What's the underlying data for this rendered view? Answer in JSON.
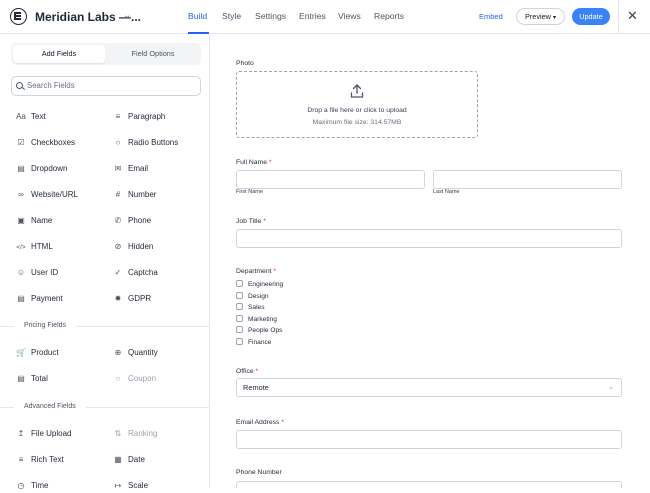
{
  "header": {
    "title": "Meridian Labs —...",
    "tabs": [
      "Build",
      "Style",
      "Settings",
      "Entries",
      "Views",
      "Reports"
    ],
    "embed_label": "Embed",
    "preview_label": "Preview",
    "update_label": "Update"
  },
  "sidebar": {
    "tabs": [
      "Add Fields",
      "Field Options"
    ],
    "search_placeholder": "Search Fields",
    "fields": [
      {
        "label": "Text",
        "icon": "text-icon"
      },
      {
        "label": "Paragraph",
        "icon": "paragraph-icon"
      },
      {
        "label": "Checkboxes",
        "icon": "checkbox-icon"
      },
      {
        "label": "Radio Buttons",
        "icon": "radio-icon"
      },
      {
        "label": "Dropdown",
        "icon": "dropdown-icon"
      },
      {
        "label": "Email",
        "icon": "email-icon"
      },
      {
        "label": "Website/URL",
        "icon": "link-icon"
      },
      {
        "label": "Number",
        "icon": "hash-icon"
      },
      {
        "label": "Name",
        "icon": "name-card-icon"
      },
      {
        "label": "Phone",
        "icon": "phone-icon"
      },
      {
        "label": "HTML",
        "icon": "code-icon"
      },
      {
        "label": "Hidden",
        "icon": "hidden-icon"
      },
      {
        "label": "User ID",
        "icon": "user-icon"
      },
      {
        "label": "Captcha",
        "icon": "shield-check-icon"
      },
      {
        "label": "Payment",
        "icon": "credit-card-icon"
      },
      {
        "label": "GDPR",
        "icon": "gdpr-stars-icon"
      }
    ],
    "pricing_heading": "Pricing Fields",
    "pricing_fields": [
      {
        "label": "Product",
        "icon": "cart-icon",
        "dim": false
      },
      {
        "label": "Quantity",
        "icon": "quantity-icon",
        "dim": false
      },
      {
        "label": "Total",
        "icon": "total-icon",
        "dim": false
      },
      {
        "label": "Coupon",
        "icon": "coupon-icon",
        "dim": true
      }
    ],
    "advanced_heading": "Advanced Fields",
    "advanced_fields": [
      {
        "label": "File Upload",
        "icon": "upload-icon",
        "dim": false
      },
      {
        "label": "Ranking",
        "icon": "ranking-icon",
        "dim": true
      },
      {
        "label": "Rich Text",
        "icon": "rich-text-icon",
        "dim": false
      },
      {
        "label": "Date",
        "icon": "calendar-icon",
        "dim": false
      },
      {
        "label": "Time",
        "icon": "clock-icon",
        "dim": false
      },
      {
        "label": "Scale",
        "icon": "scale-icon",
        "dim": false
      }
    ]
  },
  "form": {
    "photo": {
      "label": "Photo",
      "drop_text": "Drop a file here or click to upload",
      "max_size_text": "Maximum file size: 314.57MB"
    },
    "full_name": {
      "label": "Full Name",
      "required_mark": "*",
      "first_sub": "First Name",
      "last_sub": "Last Name"
    },
    "job_title": {
      "label": "Job Title",
      "required_mark": "*"
    },
    "department": {
      "label": "Department",
      "required_mark": "*",
      "options": [
        "Engineering",
        "Design",
        "Sales",
        "Marketing",
        "People Ops",
        "Finance"
      ]
    },
    "office": {
      "label": "Office",
      "required_mark": "*",
      "value": "Remote"
    },
    "email": {
      "label": "Email Address",
      "required_mark": "*"
    },
    "phone": {
      "label": "Phone Number"
    }
  },
  "colors": {
    "accent": "#3b82f6",
    "link": "#2563eb",
    "required": "#dc2626"
  }
}
